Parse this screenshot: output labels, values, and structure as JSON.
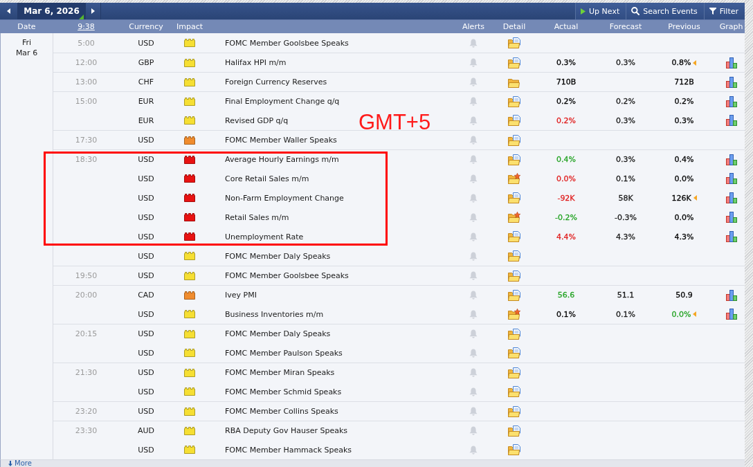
{
  "toolbar": {
    "date": "Mar 6, 2026",
    "buttons": [
      {
        "kind": "up-next",
        "label": "Up Next"
      },
      {
        "kind": "search",
        "label": "Search Events"
      },
      {
        "kind": "filter",
        "label": "Filter"
      }
    ]
  },
  "columns": [
    {
      "kind": "date",
      "label": "Date"
    },
    {
      "kind": "clock",
      "label": "9:38"
    },
    {
      "kind": "currency",
      "label": "Currency"
    },
    {
      "kind": "impact",
      "label": "Impact"
    },
    {
      "kind": "alerts",
      "label": "Alerts"
    },
    {
      "kind": "detail",
      "label": "Detail"
    },
    {
      "kind": "actual",
      "label": "Actual"
    },
    {
      "kind": "forecast",
      "label": "Forecast"
    },
    {
      "kind": "previous",
      "label": "Previous"
    },
    {
      "kind": "graph",
      "label": "Graph"
    }
  ],
  "day": {
    "weekday": "Fri",
    "date": "Mar 6"
  },
  "rows": [
    {
      "time": "5:00",
      "currency": "USD",
      "impact": {
        "color": "#f6df33"
      },
      "event": "FOMC Member Goolsbee Speaks",
      "detail": {
        "kind": "doc"
      }
    },
    {
      "time": "12:00",
      "currency": "GBP",
      "impact": {
        "color": "#f6df33"
      },
      "event": "Halifax HPI m/m",
      "detail": {
        "kind": "doc"
      },
      "actual": {
        "text": "0.3%",
        "color": "#000000"
      },
      "forecast": "0.3%",
      "previous": {
        "text": "0.8%",
        "color": "#000000",
        "revised": true
      },
      "graph": true
    },
    {
      "time": "13:00",
      "currency": "CHF",
      "impact": {
        "color": "#f6df33"
      },
      "event": "Foreign Currency Reserves",
      "detail": {
        "kind": "plain"
      },
      "actual": {
        "text": "710B",
        "color": "#000000"
      },
      "previous": {
        "text": "712B",
        "color": "#000000"
      },
      "graph": true
    },
    {
      "time": "15:00",
      "currency": "EUR",
      "impact": {
        "color": "#f6df33"
      },
      "event": "Final Employment Change q/q",
      "detail": {
        "kind": "doc"
      },
      "actual": {
        "text": "0.2%",
        "color": "#000000"
      },
      "forecast": "0.2%",
      "previous": {
        "text": "0.2%",
        "color": "#000000"
      },
      "graph": true
    },
    {
      "currency": "EUR",
      "impact": {
        "color": "#f6df33"
      },
      "event": "Revised GDP q/q",
      "detail": {
        "kind": "doc"
      },
      "actual": {
        "text": "0.2%",
        "color": "#e01b1b"
      },
      "forecast": "0.3%",
      "previous": {
        "text": "0.3%",
        "color": "#000000"
      },
      "graph": true
    },
    {
      "time": "17:30",
      "currency": "USD",
      "impact": {
        "color": "#f08c2e"
      },
      "event": "FOMC Member Waller Speaks",
      "detail": {
        "kind": "doc"
      }
    },
    {
      "time": "18:30",
      "currency": "USD",
      "impact": {
        "color": "#e81212"
      },
      "event": "Average Hourly Earnings m/m",
      "detail": {
        "kind": "doc"
      },
      "actual": {
        "text": "0.4%",
        "color": "#23a323"
      },
      "forecast": "0.3%",
      "previous": {
        "text": "0.4%",
        "color": "#000000"
      },
      "graph": true
    },
    {
      "currency": "USD",
      "impact": {
        "color": "#e81212"
      },
      "event": "Core Retail Sales m/m",
      "detail": {
        "kind": "star"
      },
      "actual": {
        "text": "0.0%",
        "color": "#e01b1b"
      },
      "forecast": "0.1%",
      "previous": {
        "text": "0.0%",
        "color": "#000000"
      },
      "graph": true
    },
    {
      "currency": "USD",
      "impact": {
        "color": "#e81212"
      },
      "event": "Non-Farm Employment Change",
      "detail": {
        "kind": "doc"
      },
      "actual": {
        "text": "-92K",
        "color": "#e01b1b"
      },
      "forecast": "58K",
      "previous": {
        "text": "126K",
        "color": "#000000",
        "revised": true
      },
      "graph": true
    },
    {
      "currency": "USD",
      "impact": {
        "color": "#e81212"
      },
      "event": "Retail Sales m/m",
      "detail": {
        "kind": "star"
      },
      "actual": {
        "text": "-0.2%",
        "color": "#23a323"
      },
      "forecast": "-0.3%",
      "previous": {
        "text": "0.0%",
        "color": "#000000"
      },
      "graph": true
    },
    {
      "currency": "USD",
      "impact": {
        "color": "#e81212"
      },
      "event": "Unemployment Rate",
      "detail": {
        "kind": "doc"
      },
      "actual": {
        "text": "4.4%",
        "color": "#e01b1b"
      },
      "forecast": "4.3%",
      "previous": {
        "text": "4.3%",
        "color": "#000000"
      },
      "graph": true
    },
    {
      "currency": "USD",
      "impact": {
        "color": "#f6df33"
      },
      "event": "FOMC Member Daly Speaks",
      "detail": {
        "kind": "doc"
      }
    },
    {
      "time": "19:50",
      "currency": "USD",
      "impact": {
        "color": "#f6df33"
      },
      "event": "FOMC Member Goolsbee Speaks",
      "detail": {
        "kind": "doc"
      }
    },
    {
      "time": "20:00",
      "currency": "CAD",
      "impact": {
        "color": "#f08c2e"
      },
      "event": "Ivey PMI",
      "detail": {
        "kind": "doc"
      },
      "actual": {
        "text": "56.6",
        "color": "#23a323"
      },
      "forecast": "51.1",
      "previous": {
        "text": "50.9",
        "color": "#000000"
      },
      "graph": true
    },
    {
      "currency": "USD",
      "impact": {
        "color": "#f6df33"
      },
      "event": "Business Inventories m/m",
      "detail": {
        "kind": "star"
      },
      "actual": {
        "text": "0.1%",
        "color": "#000000"
      },
      "forecast": "0.1%",
      "previous": {
        "text": "0.0%",
        "color": "#23a323",
        "revised": true
      },
      "graph": true
    },
    {
      "time": "20:15",
      "currency": "USD",
      "impact": {
        "color": "#f6df33"
      },
      "event": "FOMC Member Daly Speaks",
      "detail": {
        "kind": "doc"
      }
    },
    {
      "currency": "USD",
      "impact": {
        "color": "#f6df33"
      },
      "event": "FOMC Member Paulson Speaks",
      "detail": {
        "kind": "doc"
      }
    },
    {
      "time": "21:30",
      "currency": "USD",
      "impact": {
        "color": "#f6df33"
      },
      "event": "FOMC Member Miran Speaks",
      "detail": {
        "kind": "doc"
      }
    },
    {
      "currency": "USD",
      "impact": {
        "color": "#f6df33"
      },
      "event": "FOMC Member Schmid Speaks",
      "detail": {
        "kind": "doc"
      }
    },
    {
      "time": "23:20",
      "currency": "USD",
      "impact": {
        "color": "#f6df33"
      },
      "event": "FOMC Member Collins Speaks",
      "detail": {
        "kind": "doc"
      }
    },
    {
      "time": "23:30",
      "currency": "AUD",
      "impact": {
        "color": "#f6df33"
      },
      "event": "RBA Deputy Gov Hauser Speaks",
      "detail": {
        "kind": "doc"
      }
    },
    {
      "currency": "USD",
      "impact": {
        "color": "#f6df33"
      },
      "event": "FOMC Member Hammack Speaks",
      "detail": {
        "kind": "doc"
      }
    }
  ],
  "annotations": [
    {
      "kind": "rectangle"
    },
    {
      "kind": "label",
      "text": "GMT+5"
    }
  ],
  "more": {
    "label": "More"
  }
}
